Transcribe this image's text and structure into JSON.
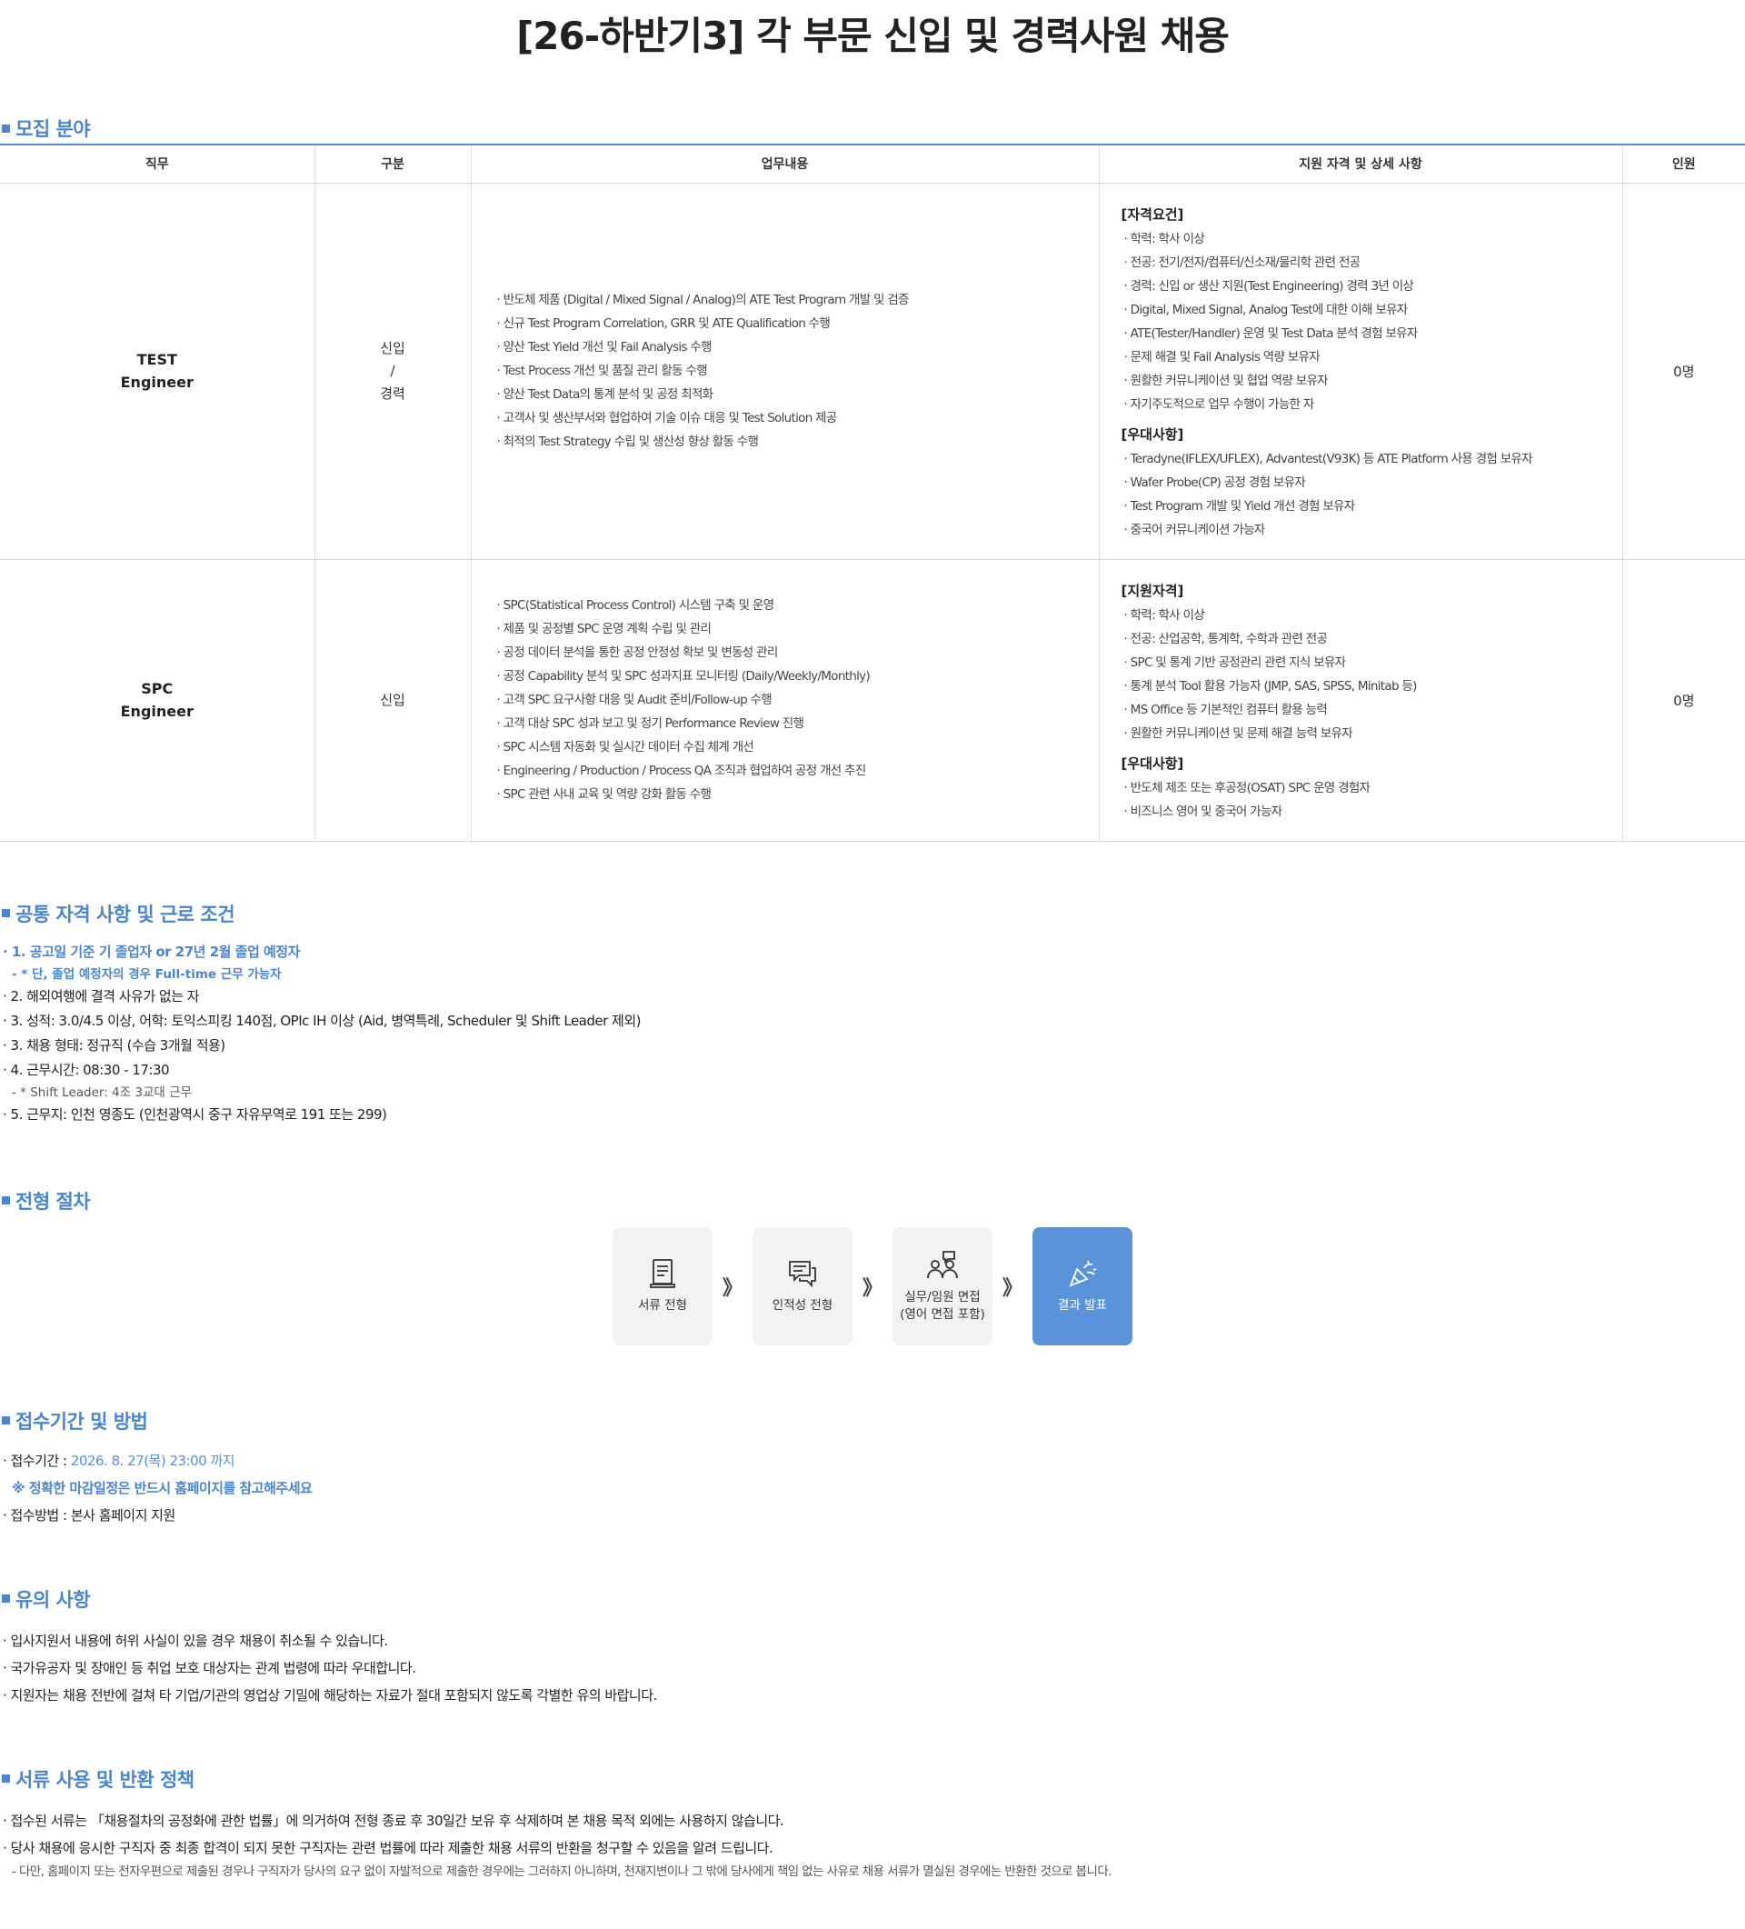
{
  "title": "[26-하반기3] 각 부문 신입 및 경력사원 채용",
  "sections": {
    "recruit": "모집 분야",
    "common": "공통 자격 사항 및 근로 조건",
    "process": "전형 절차",
    "apply": "접수기간 및 방법",
    "notice": "유의 사항",
    "policy": "서류 사용 및 반환 정책"
  },
  "table": {
    "headers": [
      "직무",
      "구분",
      "업무내용",
      "지원 자격 및 상세 사항",
      "인원"
    ],
    "rows": [
      {
        "job_line1": "TEST",
        "job_line2": "Engineer",
        "kind_line1": "신입",
        "kind_line2": "/",
        "kind_line3": "경력",
        "duties": [
          "· 반도체 제품 (Digital / Mixed Signal / Analog)의 ATE Test Program 개발 및 검증",
          "· 신규 Test Program Correlation, GRR 및 ATE Qualification 수행",
          "· 양산 Test Yield 개선 및 Fail Analysis 수행",
          "· Test Process 개선 및 품질 관리 활동 수행",
          "· 양산 Test Data의 통계 분석 및 공정 최적화",
          "· 고객사 및 생산부서와 협업하여 기술 이슈 대응 및 Test Solution 제공",
          "· 최적의 Test Strategy 수립 및 생산성 향상 활동 수행"
        ],
        "qual_head1": "[자격요건]",
        "qual_list1": [
          "· 학력: 학사 이상",
          "· 전공: 전기/전자/컴퓨터/신소재/물리학 관련 전공",
          "· 경력: 신입 or 생산 지원(Test Engineering) 경력 3년 이상",
          "· Digital, Mixed Signal, Analog Test에 대한 이해 보유자",
          "· ATE(Tester/Handler) 운영 및 Test Data 분석 경험 보유자",
          "· 문제 해결 및 Fail Analysis 역량 보유자",
          "· 원활한 커뮤니케이션 및 협업 역량 보유자",
          "· 자기주도적으로 업무 수행이 가능한 자"
        ],
        "qual_head2": "[우대사항]",
        "qual_list2": [
          "· Teradyne(IFLEX/UFLEX), Advantest(V93K) 등 ATE Platform 사용 경험 보유자",
          "· Wafer Probe(CP) 공정 경험 보유자",
          "· Test Program 개발 및 Yield 개선 경험 보유자",
          "· 중국어 커뮤니케이션 가능자"
        ],
        "count": "0명"
      },
      {
        "job_line1": "SPC",
        "job_line2": "Engineer",
        "kind_line1": "신입",
        "duties": [
          "· SPC(Statistical Process Control) 시스템 구축 및 운영",
          "· 제품 및 공정별 SPC 운영 계획 수립 및 관리",
          "· 공정 데이터 분석을 통한 공정 안정성 확보 및 변동성 관리",
          "· 공정 Capability 분석 및 SPC 성과지표 모니터링 (Daily/Weekly/Monthly)",
          "· 고객 SPC 요구사항 대응 및 Audit 준비/Follow-up 수행",
          "· 고객 대상 SPC 성과 보고 및 정기 Performance Review 진행",
          "· SPC 시스템 자동화 및 실시간 데이터 수집 체계 개선",
          "· Engineering / Production / Process QA 조직과 협업하여 공정 개선 추진",
          "· SPC 관련 사내 교육 및 역량 강화 활동 수행"
        ],
        "qual_head1": "[지원자격]",
        "qual_list1": [
          "· 학력: 학사 이상",
          "· 전공: 산업공학, 통계학, 수학과 관련 전공",
          "· SPC 및 통계 기반 공정관리 관련 지식 보유자",
          "· 통계 분석 Tool 활용 가능자 (JMP, SAS, SPSS, Minitab 등)",
          "· MS Office 등 기본적인 컴퓨터 활용 능력",
          "· 원활한 커뮤니케이션 및 문제 해결 능력 보유자"
        ],
        "qual_head2": "[우대사항]",
        "qual_list2": [
          "· 반도체 제조 또는 후공정(OSAT) SPC 운영 경험자",
          "· 비즈니스 영어 및 중국어 가능자"
        ],
        "count": "0명"
      }
    ]
  },
  "common": {
    "line1": "· 1. 공고일 기준 기 졸업자 or 27년 2월 졸업 예정자",
    "line1_sub": "- * 단, 졸업 예정자의 경우 Full-time 근무 가능자",
    "line2": "· 2. 해외여행에 결격 사유가 없는 자",
    "line3": "· 3. 성적: 3.0/4.5 이상, 어학: 토익스피킹 140점, OPIc IH 이상 (Aid, 병역특례, Scheduler 및 Shift Leader 제외)",
    "line4": "· 3. 채용 형태: 정규직 (수습 3개월 적용)",
    "line5": "· 4. 근무시간: 08:30 - 17:30",
    "line5_sub": "- * Shift Leader: 4조 3교대 근무",
    "line6": "· 5. 근무지: 인천 영종도 (인천광역시 중구 자유무역로 191 또는 299)"
  },
  "process": {
    "steps": [
      {
        "label": "서류 전형",
        "icon": "document-icon"
      },
      {
        "label": "인적성 전형",
        "icon": "chat-icon"
      },
      {
        "label_line1": "실무/임원 면접",
        "label_line2": "(영어 면접 포함)",
        "icon": "interview-icon"
      },
      {
        "label": "결과 발표",
        "icon": "party-popper-icon"
      }
    ],
    "arrow": "》",
    "final_color": "#5b93da"
  },
  "apply": {
    "period_label": "· 접수기간 : ",
    "period_value": "2026. 8. 27(목) 23:00 까지",
    "note": "※ 정확한 마감일정은 반드시 홈페이지를 참고해주세요",
    "method": "· 접수방법 : 본사 홈페이지 지원"
  },
  "notice": [
    "· 입사지원서 내용에 허위 사실이 있을 경우 채용이 취소될 수 있습니다.",
    "· 국가유공자 및 장애인 등 취업 보호 대상자는 관계 법령에 따라 우대합니다.",
    "· 지원자는 채용 전반에 걸쳐 타 기업/기관의 영업상 기밀에 해당하는 자료가 절대 포함되지 않도록 각별한 유의 바랍니다."
  ],
  "policy": {
    "line1": "· 접수된 서류는 「채용절차의 공정화에 관한 법률」에 의거하여 전형 종료 후 30일간 보유 후 삭제하며 본 채용 목적 외에는 사용하지 않습니다.",
    "line2": "· 당사 채용에 응시한 구직자 중 최종 합격이 되지 못한 구직자는 관련 법률에 따라 제출한 채용 서류의 반환을 청구할 수 있음을 알려 드립니다.",
    "line2_sub": "- 다만, 홈페이지 또는 전자우편으로 제출된 경우나 구직자가 당사의 요구 없이 자발적으로 제출한 경우에는 그러하지 아니하며, 천재지변이나 그 밖에 당사에게 책임 없는 사유로 채용 서류가 멸실된 경우에는 반환한 것으로 봅니다."
  },
  "accent_color": "#4a86cf"
}
